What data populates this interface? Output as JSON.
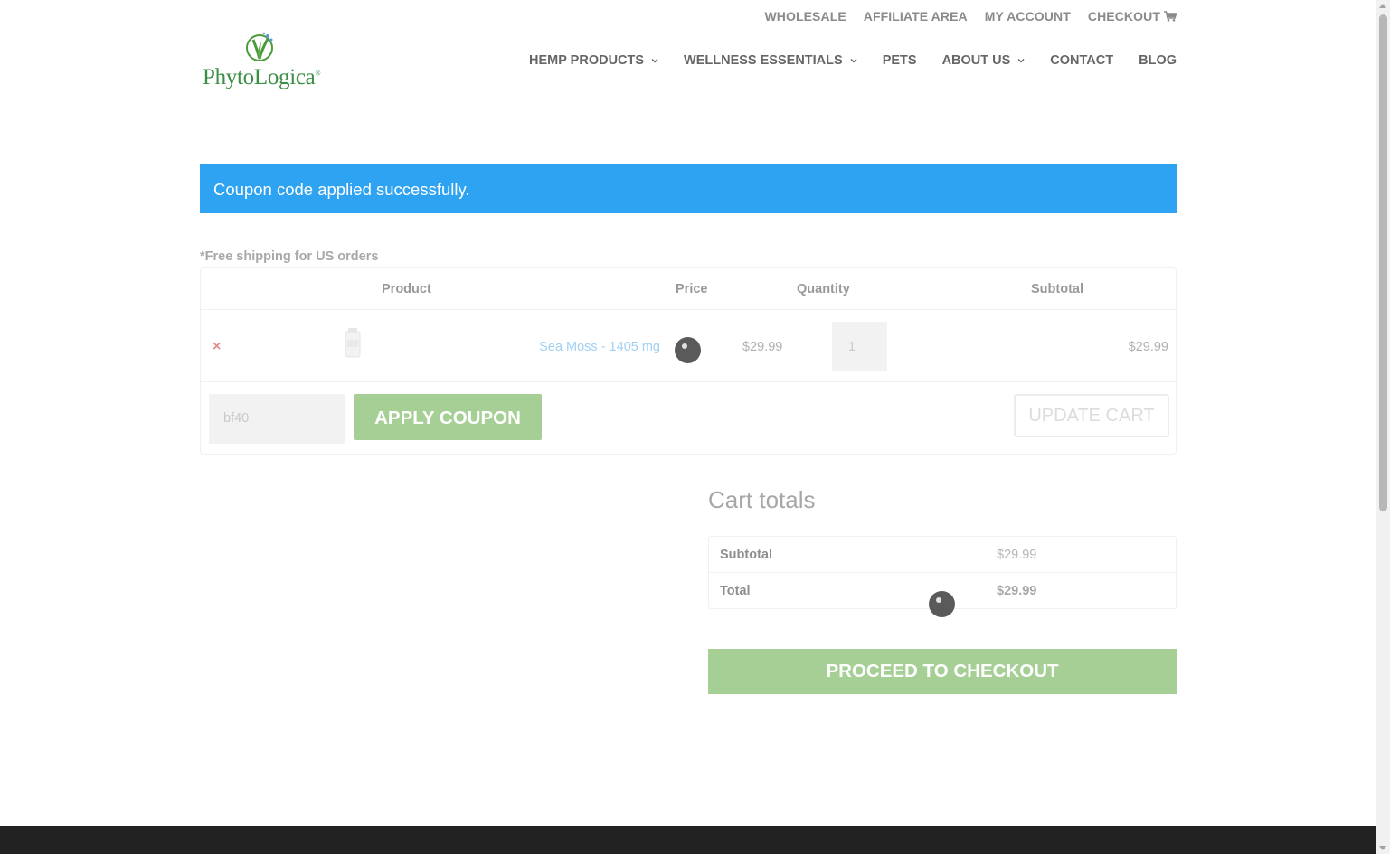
{
  "top_links": [
    {
      "label": "WHOLESALE"
    },
    {
      "label": "AFFILIATE AREA"
    },
    {
      "label": "MY ACCOUNT"
    },
    {
      "label": "CHECKOUT"
    }
  ],
  "checkout_icon": "cart-icon",
  "logo": {
    "text": "PhytoLogica",
    "mark": "registered",
    "brand_color": "#3a8e45"
  },
  "main_nav": [
    {
      "label": "HEMP PRODUCTS",
      "has_dropdown": true
    },
    {
      "label": "WELLNESS ESSENTIALS",
      "has_dropdown": true
    },
    {
      "label": "PETS",
      "has_dropdown": false
    },
    {
      "label": "ABOUT US",
      "has_dropdown": true
    },
    {
      "label": "CONTACT",
      "has_dropdown": false
    },
    {
      "label": "BLOG",
      "has_dropdown": false
    }
  ],
  "notice": {
    "text": "Coupon code applied successfully.",
    "color": "#2ea3f2"
  },
  "shipping_note": "*Free shipping for US orders",
  "cart": {
    "headers": {
      "product": "Product",
      "price": "Price",
      "quantity": "Quantity",
      "subtotal": "Subtotal"
    },
    "items": [
      {
        "remove": "×",
        "name": "Sea Moss - 1405 mg",
        "price": "$29.99",
        "quantity": "1",
        "subtotal": "$29.99"
      }
    ],
    "coupon_value": "bf40",
    "apply_label": "APPLY COUPON",
    "update_label": "UPDATE CART"
  },
  "totals": {
    "title": "Cart totals",
    "subtotal_label": "Subtotal",
    "subtotal_value": "$29.99",
    "total_label": "Total",
    "total_value": "$29.99",
    "checkout_label": "PROCEED TO CHECKOUT"
  },
  "colors": {
    "button_green": "#a6cf95",
    "link_blue": "#9fd1f3",
    "footer": "#222222"
  }
}
